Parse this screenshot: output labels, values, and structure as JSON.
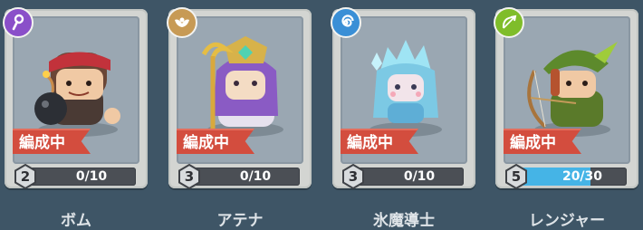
{
  "colors": {
    "background": "#3e5566",
    "card": "#d3d5d2",
    "formation_tag": "#d34d3e",
    "level_fill": "#45b4e6",
    "class_icons": [
      "#8a4fc9",
      "#c79a55",
      "#3a8fd6",
      "#7fbd2a"
    ]
  },
  "characters": [
    {
      "name": "ボム",
      "status": "編成中",
      "level": "2",
      "exp": "0/10",
      "exp_progress": 0,
      "class_icon": "staff-icon",
      "portrait": "bomber-pirate-portrait"
    },
    {
      "name": "アテナ",
      "status": "編成中",
      "level": "3",
      "exp": "0/10",
      "exp_progress": 0,
      "class_icon": "winged-crest-icon",
      "portrait": "athena-priestess-portrait"
    },
    {
      "name": "氷魔導士",
      "status": "編成中",
      "level": "3",
      "exp": "0/10",
      "exp_progress": 0,
      "class_icon": "spiral-icon",
      "portrait": "ice-mage-portrait"
    },
    {
      "name": "レンジャー",
      "status": "編成中",
      "level": "5",
      "exp": "20/30",
      "exp_progress": 0.667,
      "class_icon": "bow-arrow-icon",
      "portrait": "ranger-archer-portrait"
    }
  ]
}
